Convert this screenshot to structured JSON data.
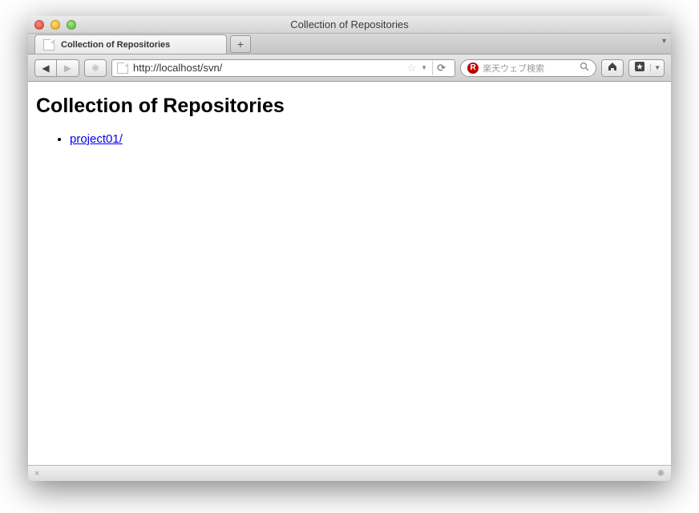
{
  "window": {
    "title": "Collection of Repositories"
  },
  "tabs": [
    {
      "label": "Collection of Repositories"
    }
  ],
  "newtab_label": "+",
  "nav": {
    "back": "◀",
    "forward": "▶",
    "activity": "❋"
  },
  "urlbar": {
    "value": "http://localhost/svn/",
    "star": "☆",
    "reload": "⟳"
  },
  "search": {
    "engine_badge": "R",
    "placeholder": "楽天ウェブ検索",
    "glass": "🔍"
  },
  "toolbar": {
    "home": "⌂",
    "bookmarks": "★"
  },
  "page": {
    "heading": "Collection of Repositories",
    "items": [
      {
        "label": "project01/"
      }
    ]
  },
  "statusbar": {
    "left": "×",
    "right": "❋"
  }
}
